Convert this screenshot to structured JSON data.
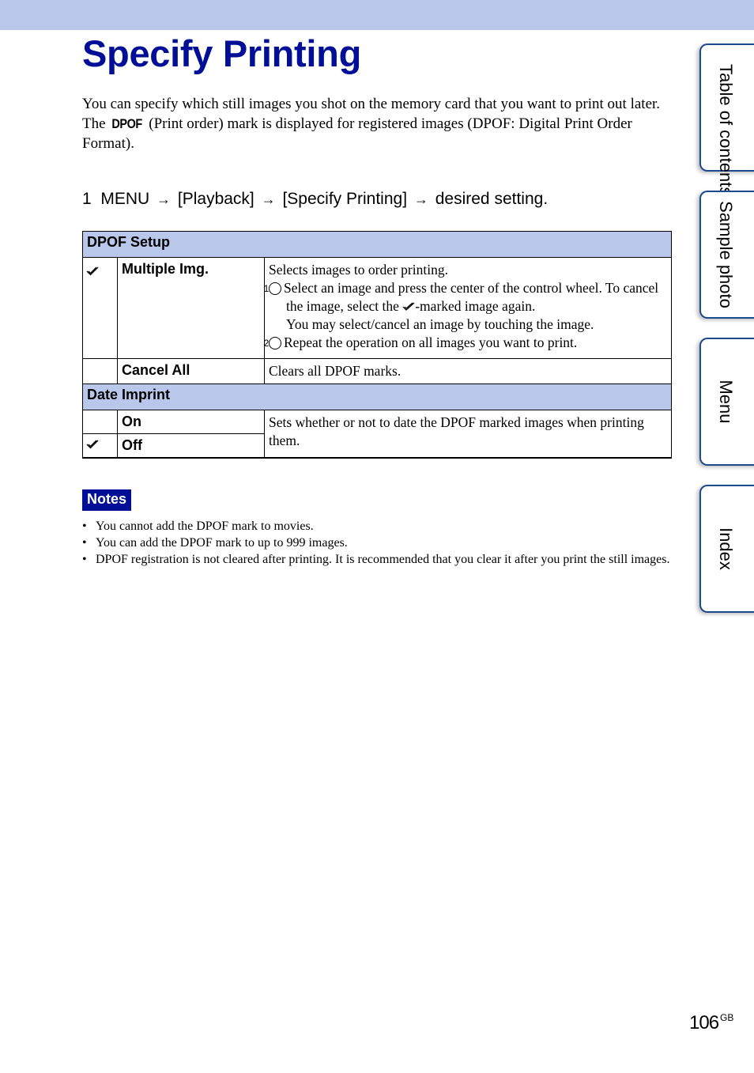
{
  "title": "Specify Printing",
  "intro": {
    "line1": "You can specify which still images you shot on the memory card that you want to print out later.",
    "line2_pre": "The ",
    "dpof_mark": "DPOF",
    "line2_post": " (Print order) mark is displayed for registered images (DPOF: Digital Print Order Format)."
  },
  "step": {
    "number": "1",
    "parts": [
      "MENU",
      "[Playback]",
      "[Specify Printing]",
      "desired setting."
    ],
    "arrow": "→"
  },
  "table": {
    "sections": [
      {
        "header": "DPOF Setup",
        "rows": [
          {
            "checked": true,
            "name": "Multiple Img.",
            "desc_intro": "Selects images to order printing.",
            "step1_num": "1",
            "step1_a": "Select an image and press the center of the control wheel. To cancel the image, select the ",
            "step1_b": "-marked image again.",
            "step1_c": "You may select/cancel an image by touching the image.",
            "step2_num": "2",
            "step2": "Repeat the operation on all images you want to print."
          },
          {
            "checked": false,
            "name": "Cancel All",
            "desc": "Clears all DPOF marks."
          }
        ]
      },
      {
        "header": "Date Imprint",
        "rows": [
          {
            "checked": false,
            "name": "On"
          },
          {
            "checked": true,
            "name": "Off"
          }
        ],
        "desc": "Sets whether or not to date the DPOF marked images when printing them."
      }
    ]
  },
  "notes": {
    "label": "Notes",
    "items": [
      "You cannot add the DPOF mark to movies.",
      "You can add the DPOF mark to up to 999 images.",
      "DPOF registration is not cleared after printing. It is recommended that you clear it after you print the still images."
    ]
  },
  "side_tabs": [
    "Table of contents",
    "Sample photo",
    "Menu",
    "Index"
  ],
  "page": {
    "number": "106",
    "suffix": "GB"
  },
  "colors": {
    "title": "#000f96",
    "band": "#b8c7ea",
    "tab_border": "#1d4a8c"
  }
}
